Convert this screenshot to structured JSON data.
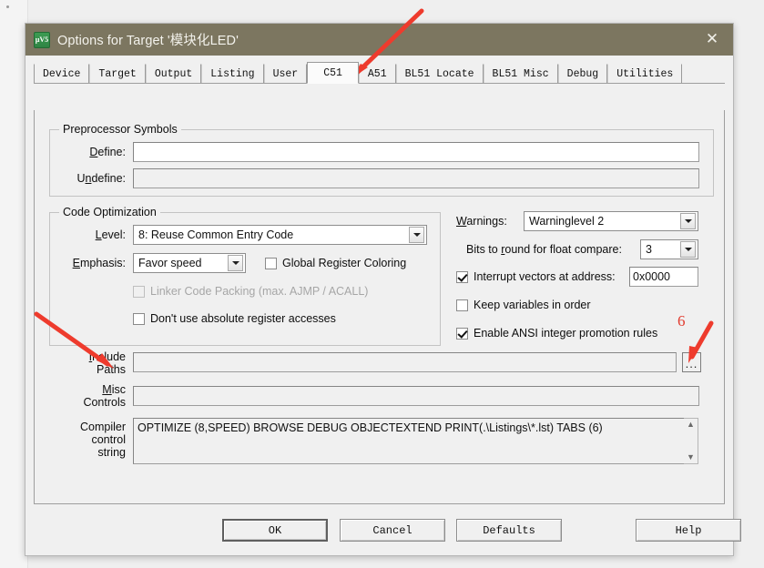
{
  "window": {
    "title": "Options for Target '模块化LED'",
    "icon": "uvision-logo-icon",
    "close_label": "✕"
  },
  "tabs": [
    {
      "label": "Device",
      "active": false
    },
    {
      "label": "Target",
      "active": false
    },
    {
      "label": "Output",
      "active": false
    },
    {
      "label": "Listing",
      "active": false
    },
    {
      "label": "User",
      "active": false
    },
    {
      "label": "C51",
      "active": true
    },
    {
      "label": "A51",
      "active": false
    },
    {
      "label": "BL51 Locate",
      "active": false
    },
    {
      "label": "BL51 Misc",
      "active": false
    },
    {
      "label": "Debug",
      "active": false
    },
    {
      "label": "Utilities",
      "active": false
    }
  ],
  "preprocessor": {
    "legend": "Preprocessor Symbols",
    "define_label": "Define:",
    "define_value": "",
    "undefine_label": "Undefine:",
    "undefine_value": ""
  },
  "code_optimization": {
    "legend": "Code Optimization",
    "level_label": "Level:",
    "level_value": "8: Reuse Common Entry Code",
    "emphasis_label": "Emphasis:",
    "emphasis_value": "Favor speed",
    "global_register_coloring": {
      "label": "Global Register Coloring",
      "checked": false,
      "enabled": true
    },
    "linker_code_packing": {
      "label": "Linker Code Packing (max. AJMP / ACALL)",
      "checked": false,
      "enabled": false
    },
    "dont_use_absolute_register": {
      "label": "Don't use absolute register accesses",
      "checked": false,
      "enabled": true
    }
  },
  "right_options": {
    "warnings_label": "Warnings:",
    "warnings_value": "Warninglevel 2",
    "bits_round_label": "Bits to round for float compare:",
    "bits_round_value": "3",
    "interrupt_vectors": {
      "label": "Interrupt vectors at address:",
      "checked": true,
      "value": "0x0000"
    },
    "keep_variables": {
      "label": "Keep variables in order",
      "checked": false
    },
    "enable_ansi": {
      "label": "Enable ANSI integer promotion rules",
      "checked": true
    }
  },
  "paths": {
    "include_label_line1": "Include",
    "include_label_line2": "Paths",
    "include_value": "",
    "browse_label": "...",
    "misc_label_line1": "Misc",
    "misc_label_line2": "Controls",
    "misc_value": "",
    "compiler_label_line1": "Compiler",
    "compiler_label_line2": "control",
    "compiler_label_line3": "string",
    "compiler_value": "OPTIMIZE (8,SPEED) BROWSE DEBUG OBJECTEXTEND PRINT(.\\Listings\\*.lst) TABS (6)",
    "scroll_up": "▲",
    "scroll_down": "▼"
  },
  "buttons": {
    "ok": "OK",
    "cancel": "Cancel",
    "defaults": "Defaults",
    "help": "Help"
  },
  "annotations": {
    "step_number": "6",
    "arrow_color": "#ee3b2d"
  }
}
